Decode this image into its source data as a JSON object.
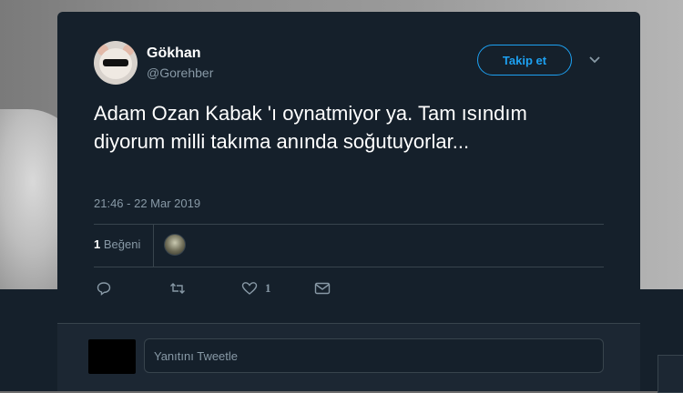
{
  "tweet": {
    "author_name": "Gökhan",
    "author_handle": "@Gorehber",
    "follow_label": "Takip et",
    "text": "Adam Ozan Kabak 'ı oynatmiyor ya. Tam ısındım diyorum milli takıma anında soğutuyorlar...",
    "timestamp": "21:46 - 22 Mar 2019",
    "likes_count": "1",
    "likes_label": "Beğeni"
  },
  "actions": {
    "reply_icon": "reply-icon",
    "retweet_icon": "retweet-icon",
    "like_icon": "heart-icon",
    "like_count": "1",
    "message_icon": "envelope-icon"
  },
  "reply": {
    "placeholder": "Yanıtını Tweetle"
  },
  "colors": {
    "background": "#15202b",
    "accent": "#1da1f2",
    "muted_text": "#8899a6",
    "border": "#38444d"
  }
}
